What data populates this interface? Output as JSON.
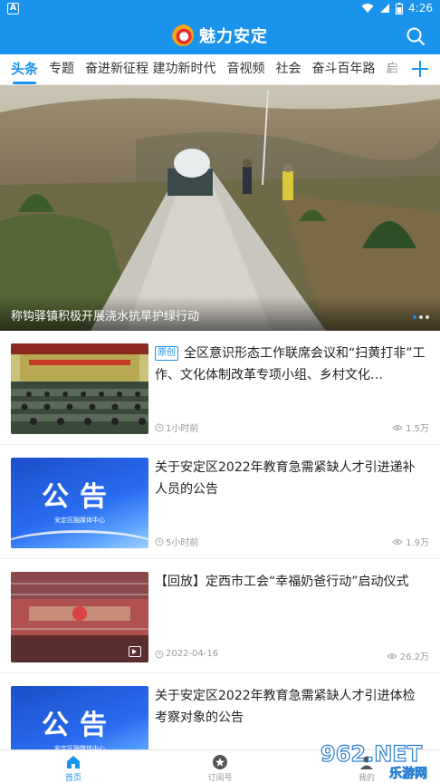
{
  "status_bar": {
    "left_icon": "A",
    "time": "4:26",
    "icons": [
      "wifi-icon",
      "signal-icon",
      "battery-icon"
    ]
  },
  "header": {
    "title": "魅力安定",
    "search_icon": "search-icon"
  },
  "tabs": [
    "头条",
    "专题",
    "奋进新征程 建功新时代",
    "音视频",
    "社会",
    "奋斗百年路",
    "启"
  ],
  "hero": {
    "caption": "称钩驿镇积极开展浇水抗旱护绿行动",
    "slide_count": 3,
    "active_slide": 1
  },
  "news": [
    {
      "badge": "原创",
      "title": "全区意识形态工作联席会议和“扫黄打非”工作、文化体制改革专项小组、乡村文化…",
      "time": "1小时前",
      "views": "1.5万",
      "thumb": "meeting"
    },
    {
      "title": "关于安定区2022年教育急需紧缺人才引进递补人员的公告",
      "time": "5小时前",
      "views": "1.9万",
      "thumb": "notice"
    },
    {
      "title": "【回放】定西市工会“幸福奶爸行动”启动仪式",
      "time": "2022-04-16",
      "views": "26.2万",
      "thumb": "video"
    },
    {
      "title": "关于安定区2022年教育急需紧缺人才引进体检考察对象的公告",
      "time": "",
      "views": "",
      "thumb": "notice"
    }
  ],
  "notice_thumb": {
    "headline": "公告",
    "org": "安定区融媒体中心"
  },
  "bottom_nav": [
    {
      "label": "首页",
      "icon": "home-icon",
      "active": true
    },
    {
      "label": "订阅号",
      "icon": "star-badge-icon",
      "active": false
    },
    {
      "label": "我的",
      "icon": "user-icon",
      "active": false
    }
  ],
  "watermark": {
    "brand": "962.NET",
    "sub": "乐游网"
  },
  "colors": {
    "primary": "#1a93ec"
  }
}
